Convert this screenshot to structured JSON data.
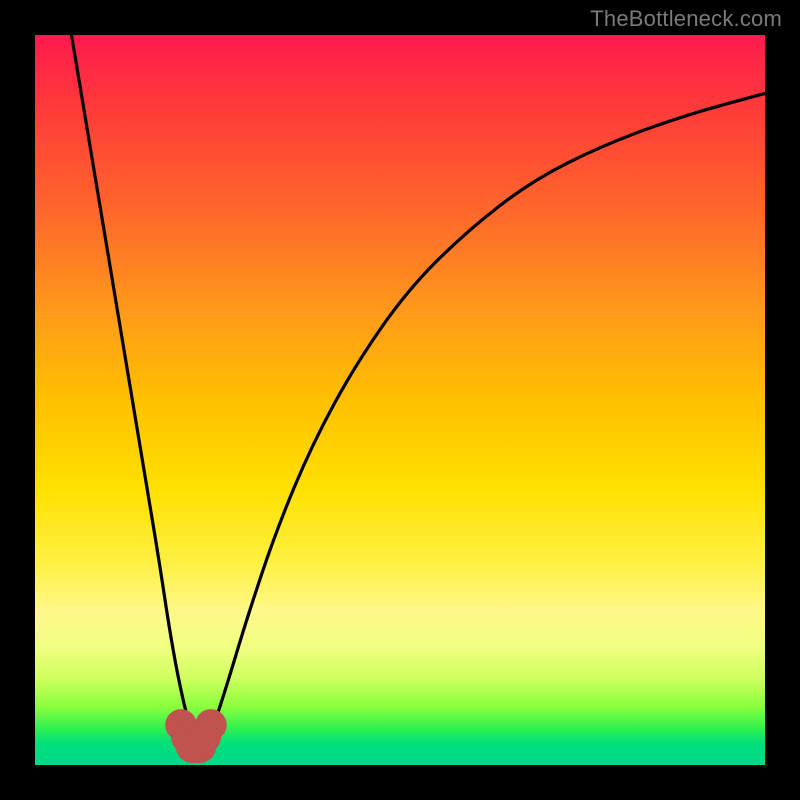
{
  "watermark": {
    "text": "TheBottleneck.com"
  },
  "chart_data": {
    "type": "line",
    "title": "",
    "xlabel": "",
    "ylabel": "",
    "xlim": [
      0,
      100
    ],
    "ylim": [
      0,
      100
    ],
    "series": [
      {
        "name": "bottleneck-curve",
        "x": [
          5,
          7,
          9,
          11,
          13,
          15,
          17,
          18.5,
          20,
          21.5,
          23,
          24,
          26,
          29,
          33,
          38,
          44,
          51,
          59,
          68,
          78,
          89,
          100
        ],
        "values": [
          100,
          88,
          76,
          64,
          52,
          40,
          28,
          18,
          10,
          4,
          2,
          4,
          10,
          20,
          32,
          44,
          55,
          65,
          73,
          80,
          85,
          89,
          92
        ]
      }
    ],
    "markers": [
      {
        "name": "min-region-dot",
        "x": 20.0,
        "y": 5.5,
        "r": 2.4,
        "color": "#c0524f"
      },
      {
        "name": "min-region-dot",
        "x": 20.8,
        "y": 3.8,
        "r": 2.4,
        "color": "#c0524f"
      },
      {
        "name": "min-region-dot",
        "x": 21.6,
        "y": 2.6,
        "r": 2.6,
        "color": "#c0524f"
      },
      {
        "name": "min-region-dot",
        "x": 22.5,
        "y": 2.6,
        "r": 2.6,
        "color": "#c0524f"
      },
      {
        "name": "min-region-dot",
        "x": 23.3,
        "y": 3.8,
        "r": 2.4,
        "color": "#c0524f"
      },
      {
        "name": "min-region-dot",
        "x": 24.1,
        "y": 5.5,
        "r": 2.4,
        "color": "#c0524f"
      }
    ],
    "colors": {
      "curve": "#000000",
      "markers": "#c0524f",
      "background_top": "#ff1a4d",
      "background_bottom": "#00d88a"
    }
  }
}
